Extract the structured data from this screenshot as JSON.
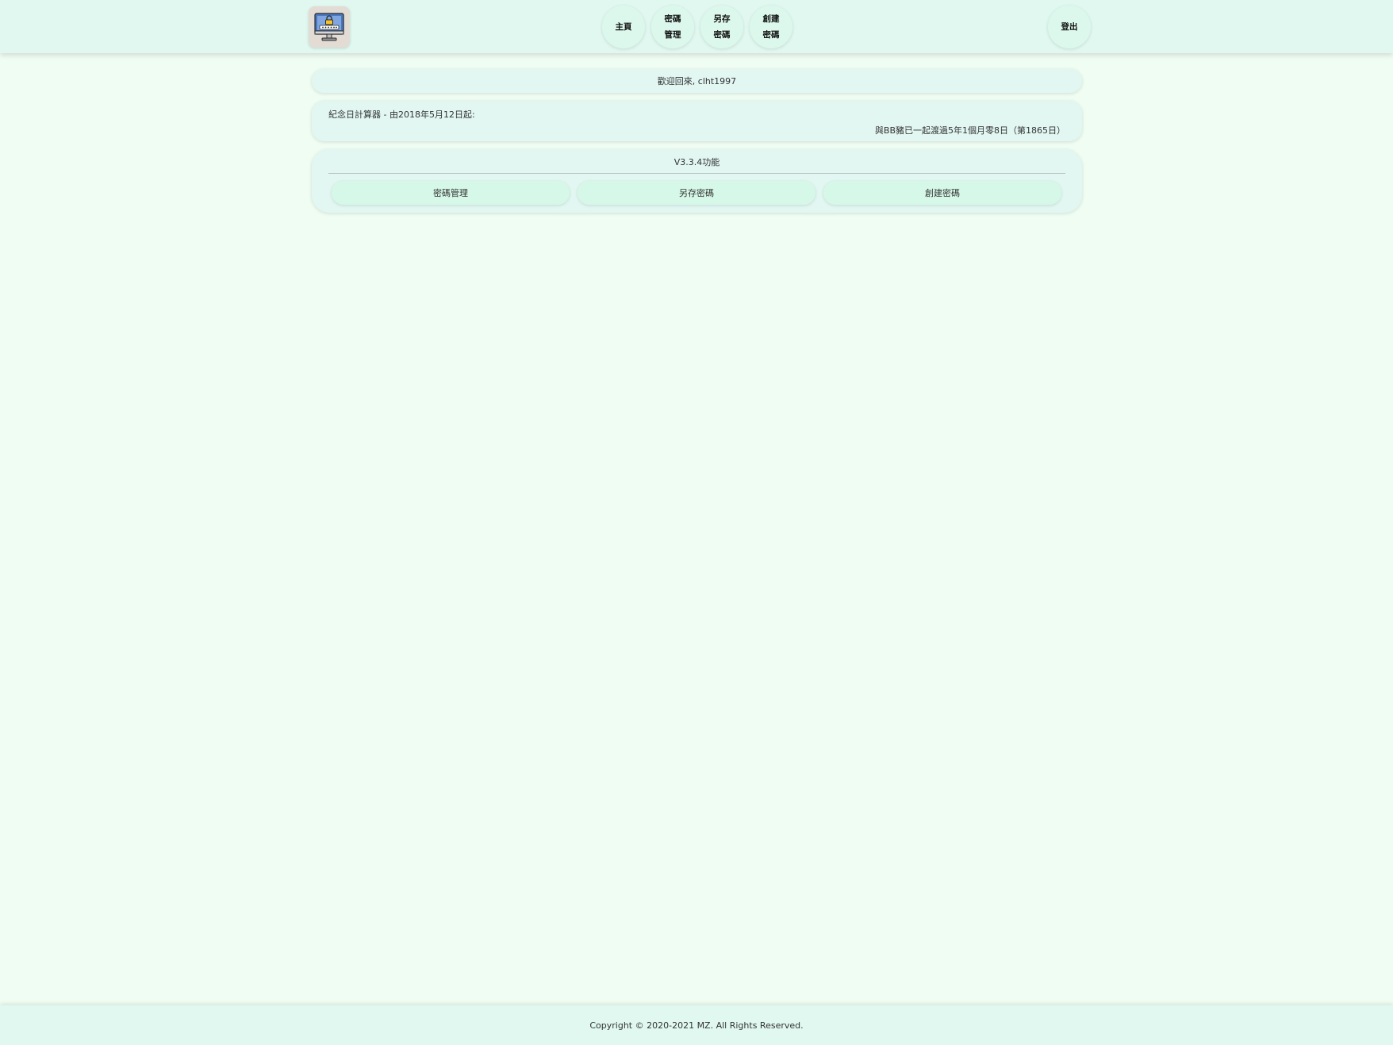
{
  "header": {
    "nav": {
      "home": "主頁",
      "password_manage": [
        "密碼",
        "管理"
      ],
      "save_password": [
        "另存",
        "密碼"
      ],
      "create_password": [
        "創建",
        "密碼"
      ],
      "logout": "登出"
    }
  },
  "welcome": {
    "text": "歡迎回來, clht1997"
  },
  "anniversary": {
    "label": "紀念日計算器 - 由2018年5月12日起:",
    "result": "與BB豬已一起渡過5年1個月零8日（第1865日）"
  },
  "features": {
    "title": "V3.3.4功能",
    "buttons": [
      "密碼管理",
      "另存密碼",
      "創建密碼"
    ]
  },
  "footer": {
    "copyright": "Copyright © 2020-2021 MZ. All Rights Reserved."
  },
  "colors": {
    "page_bg": "#effdf3",
    "bar_bg": "#e0f8f0",
    "card_bg": "#e2f7f2",
    "button_bg": "#d6f8e8"
  },
  "icons": {
    "logo": "monitor-lock-icon"
  }
}
